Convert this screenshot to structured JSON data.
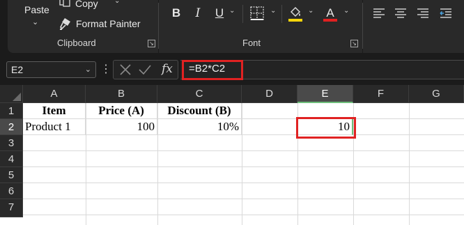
{
  "ribbon": {
    "clipboard": {
      "paste_label": "Paste",
      "copy_label": "Copy",
      "format_painter_label": "Format Painter",
      "group_label": "Clipboard"
    },
    "font": {
      "bold_label": "B",
      "italic_label": "I",
      "underline_label": "U",
      "font_color_label": "A",
      "group_label": "Font",
      "fill_color": "#f5d50a",
      "font_color": "#e02020"
    }
  },
  "formula_bar": {
    "name_box": "E2",
    "fx_label": "fx",
    "formula": "=B2*C2"
  },
  "sheet": {
    "columns": [
      "A",
      "B",
      "C",
      "D",
      "E",
      "F",
      "G"
    ],
    "rows": [
      "1",
      "2",
      "3",
      "4",
      "5",
      "6",
      "7"
    ],
    "selected_cell": "E2",
    "cells": {
      "A1": "Item",
      "B1": "Price (A)",
      "C1": "Discount (B)",
      "A2": "Product 1",
      "B2": "100",
      "C2": "10%",
      "E2": "10"
    }
  },
  "colors": {
    "highlight": "#e02222",
    "selection_accent": "#6dbd7a"
  }
}
